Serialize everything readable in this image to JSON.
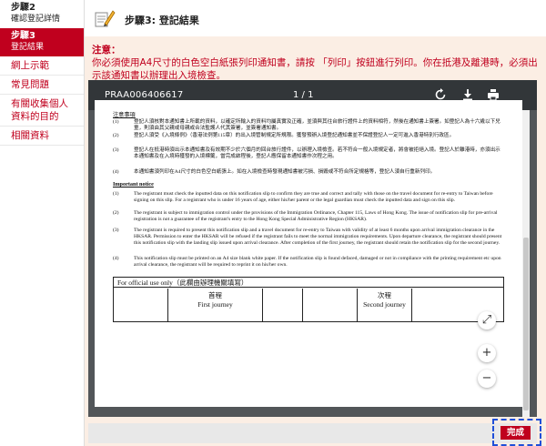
{
  "sidebar": {
    "steps": [
      {
        "num": "步驟2",
        "label": "確認登記詳情"
      },
      {
        "num": "步驟3",
        "label": "登記結果"
      }
    ],
    "links": [
      "網上示範",
      "常見問題",
      "有關收集個人資料的目的",
      "相關資料"
    ]
  },
  "header": {
    "title": "步驟3: 登記結果"
  },
  "notice": {
    "label": "注意：",
    "text": "你必須使用A4尺寸的白色空白紙張列印通知書，請按 「列印」按鈕進行列印。你在抵港及離港時，必須出示該通知書以辦理出入境檢查。"
  },
  "viewer": {
    "doc_name": "PRAA006406617",
    "page_indicator": "1 / 1",
    "icons": [
      "rotate-icon",
      "download-icon",
      "print-icon"
    ],
    "doc": {
      "title_zh": "注意事項",
      "items_zh": [
        {
          "n": "(1)",
          "t": "登記人須核對本通知書上所載的資料，以確定所輸入的資料均屬真實及正確，並須與其往台旅行證件上的資料相符，然後在通知書上簽署。如登記人為十六歲以下兒童，則須由其父親或母親或合法監護人代其簽署，並簽署通知書。"
        },
        {
          "n": "(2)",
          "t": "登記人須受《入境條例》（香港法例第115章）的出入境管制規定所規限。獲發預辦入境登記通知書並不保證登記人一定可進入香港特別行政區。"
        },
        {
          "n": "(3)",
          "t": "登記人在抵港時須出示本通知書及有效期不少於六個月的回台旅行證件，以辦理入境檢查。若不符合一般入境規定者，將會被拒絕入境。登記人於離港時，亦須出示本通知書及在入境時獲發的入境標籤，當完成啟程後，登記人應保留本通知書作次程之用。"
        },
        {
          "n": "(4)",
          "t": "本通知書須列印在A4尺寸的白色空白紙張上。如在入境檢查時發現通知書被污損、損毀或不符合所定規格等，登記人須自行重新列印。"
        }
      ],
      "title_en": "Important notice",
      "items_en": [
        {
          "n": "(1)",
          "t": "The registrant must check the inputted data on this notification slip to confirm they are true and correct and tally with those on the travel document for re-entry to Taiwan before signing on this slip. For a registrant who is under 16 years of age, either his/her parent or the legal guardian must check the inputted data and sign on this slip."
        },
        {
          "n": "(2)",
          "t": "The registrant is subject to immigration control under the provisions of the Immigration Ordinance, Chapter 115, Laws of Hong Kong. The issue of notification slip for pre-arrival registration is not a guarantee of the registrant's entry to the Hong Kong Special Administrative Region (HKSAR)."
        },
        {
          "n": "(3)",
          "t": "The registrant is required to present this notification slip and a travel document for re-entry to Taiwan with validity of at least 6 months upon arrival immigration clearance in the HKSAR. Permission to enter the HKSAR will be refused if the registrant fails to meet the normal immigration requirements. Upon departure clearance, the registrant should present this notification slip with the landing slip issued upon arrival clearance. After completion of the first journey, the registrant should retain the notification slip for the second journey."
        },
        {
          "n": "(4)",
          "t": "This notification slip must be printed on an A4 size blank white paper. If the notification slip is found defaced, damaged or not in compliance with the printing requirement etc upon arrival clearance, the registrant will be required to reprint it on his/her own."
        }
      ],
      "official_use": "For official use only（此欄由辦理機關填寫）",
      "journeys": [
        {
          "zh": "首程",
          "en": "First journey"
        },
        {
          "zh": "次程",
          "en": "Second journey"
        }
      ]
    }
  },
  "zoom_controls": {
    "fit": "⤢",
    "zoom_in": "+",
    "zoom_out": "−"
  },
  "done_button": {
    "label": "完成"
  },
  "colors": {
    "accent": "#c0001e",
    "content_bg": "#fbeee4",
    "viewer_toolbar": "#323639",
    "highlight_border": "#1f4fd8"
  }
}
